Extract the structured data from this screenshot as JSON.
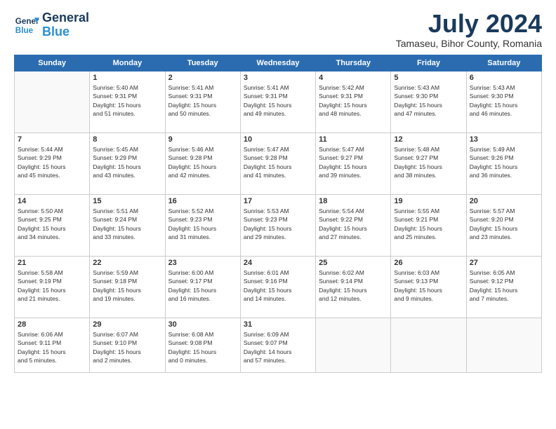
{
  "header": {
    "logo_line1": "General",
    "logo_line2": "Blue",
    "month": "July 2024",
    "location": "Tamaseu, Bihor County, Romania"
  },
  "weekdays": [
    "Sunday",
    "Monday",
    "Tuesday",
    "Wednesday",
    "Thursday",
    "Friday",
    "Saturday"
  ],
  "weeks": [
    [
      {
        "day": "",
        "info": ""
      },
      {
        "day": "1",
        "info": "Sunrise: 5:40 AM\nSunset: 9:31 PM\nDaylight: 15 hours\nand 51 minutes."
      },
      {
        "day": "2",
        "info": "Sunrise: 5:41 AM\nSunset: 9:31 PM\nDaylight: 15 hours\nand 50 minutes."
      },
      {
        "day": "3",
        "info": "Sunrise: 5:41 AM\nSunset: 9:31 PM\nDaylight: 15 hours\nand 49 minutes."
      },
      {
        "day": "4",
        "info": "Sunrise: 5:42 AM\nSunset: 9:31 PM\nDaylight: 15 hours\nand 48 minutes."
      },
      {
        "day": "5",
        "info": "Sunrise: 5:43 AM\nSunset: 9:30 PM\nDaylight: 15 hours\nand 47 minutes."
      },
      {
        "day": "6",
        "info": "Sunrise: 5:43 AM\nSunset: 9:30 PM\nDaylight: 15 hours\nand 46 minutes."
      }
    ],
    [
      {
        "day": "7",
        "info": "Sunrise: 5:44 AM\nSunset: 9:29 PM\nDaylight: 15 hours\nand 45 minutes."
      },
      {
        "day": "8",
        "info": "Sunrise: 5:45 AM\nSunset: 9:29 PM\nDaylight: 15 hours\nand 43 minutes."
      },
      {
        "day": "9",
        "info": "Sunrise: 5:46 AM\nSunset: 9:28 PM\nDaylight: 15 hours\nand 42 minutes."
      },
      {
        "day": "10",
        "info": "Sunrise: 5:47 AM\nSunset: 9:28 PM\nDaylight: 15 hours\nand 41 minutes."
      },
      {
        "day": "11",
        "info": "Sunrise: 5:47 AM\nSunset: 9:27 PM\nDaylight: 15 hours\nand 39 minutes."
      },
      {
        "day": "12",
        "info": "Sunrise: 5:48 AM\nSunset: 9:27 PM\nDaylight: 15 hours\nand 38 minutes."
      },
      {
        "day": "13",
        "info": "Sunrise: 5:49 AM\nSunset: 9:26 PM\nDaylight: 15 hours\nand 36 minutes."
      }
    ],
    [
      {
        "day": "14",
        "info": "Sunrise: 5:50 AM\nSunset: 9:25 PM\nDaylight: 15 hours\nand 34 minutes."
      },
      {
        "day": "15",
        "info": "Sunrise: 5:51 AM\nSunset: 9:24 PM\nDaylight: 15 hours\nand 33 minutes."
      },
      {
        "day": "16",
        "info": "Sunrise: 5:52 AM\nSunset: 9:23 PM\nDaylight: 15 hours\nand 31 minutes."
      },
      {
        "day": "17",
        "info": "Sunrise: 5:53 AM\nSunset: 9:23 PM\nDaylight: 15 hours\nand 29 minutes."
      },
      {
        "day": "18",
        "info": "Sunrise: 5:54 AM\nSunset: 9:22 PM\nDaylight: 15 hours\nand 27 minutes."
      },
      {
        "day": "19",
        "info": "Sunrise: 5:55 AM\nSunset: 9:21 PM\nDaylight: 15 hours\nand 25 minutes."
      },
      {
        "day": "20",
        "info": "Sunrise: 5:57 AM\nSunset: 9:20 PM\nDaylight: 15 hours\nand 23 minutes."
      }
    ],
    [
      {
        "day": "21",
        "info": "Sunrise: 5:58 AM\nSunset: 9:19 PM\nDaylight: 15 hours\nand 21 minutes."
      },
      {
        "day": "22",
        "info": "Sunrise: 5:59 AM\nSunset: 9:18 PM\nDaylight: 15 hours\nand 19 minutes."
      },
      {
        "day": "23",
        "info": "Sunrise: 6:00 AM\nSunset: 9:17 PM\nDaylight: 15 hours\nand 16 minutes."
      },
      {
        "day": "24",
        "info": "Sunrise: 6:01 AM\nSunset: 9:16 PM\nDaylight: 15 hours\nand 14 minutes."
      },
      {
        "day": "25",
        "info": "Sunrise: 6:02 AM\nSunset: 9:14 PM\nDaylight: 15 hours\nand 12 minutes."
      },
      {
        "day": "26",
        "info": "Sunrise: 6:03 AM\nSunset: 9:13 PM\nDaylight: 15 hours\nand 9 minutes."
      },
      {
        "day": "27",
        "info": "Sunrise: 6:05 AM\nSunset: 9:12 PM\nDaylight: 15 hours\nand 7 minutes."
      }
    ],
    [
      {
        "day": "28",
        "info": "Sunrise: 6:06 AM\nSunset: 9:11 PM\nDaylight: 15 hours\nand 5 minutes."
      },
      {
        "day": "29",
        "info": "Sunrise: 6:07 AM\nSunset: 9:10 PM\nDaylight: 15 hours\nand 2 minutes."
      },
      {
        "day": "30",
        "info": "Sunrise: 6:08 AM\nSunset: 9:08 PM\nDaylight: 15 hours\nand 0 minutes."
      },
      {
        "day": "31",
        "info": "Sunrise: 6:09 AM\nSunset: 9:07 PM\nDaylight: 14 hours\nand 57 minutes."
      },
      {
        "day": "",
        "info": ""
      },
      {
        "day": "",
        "info": ""
      },
      {
        "day": "",
        "info": ""
      }
    ]
  ]
}
